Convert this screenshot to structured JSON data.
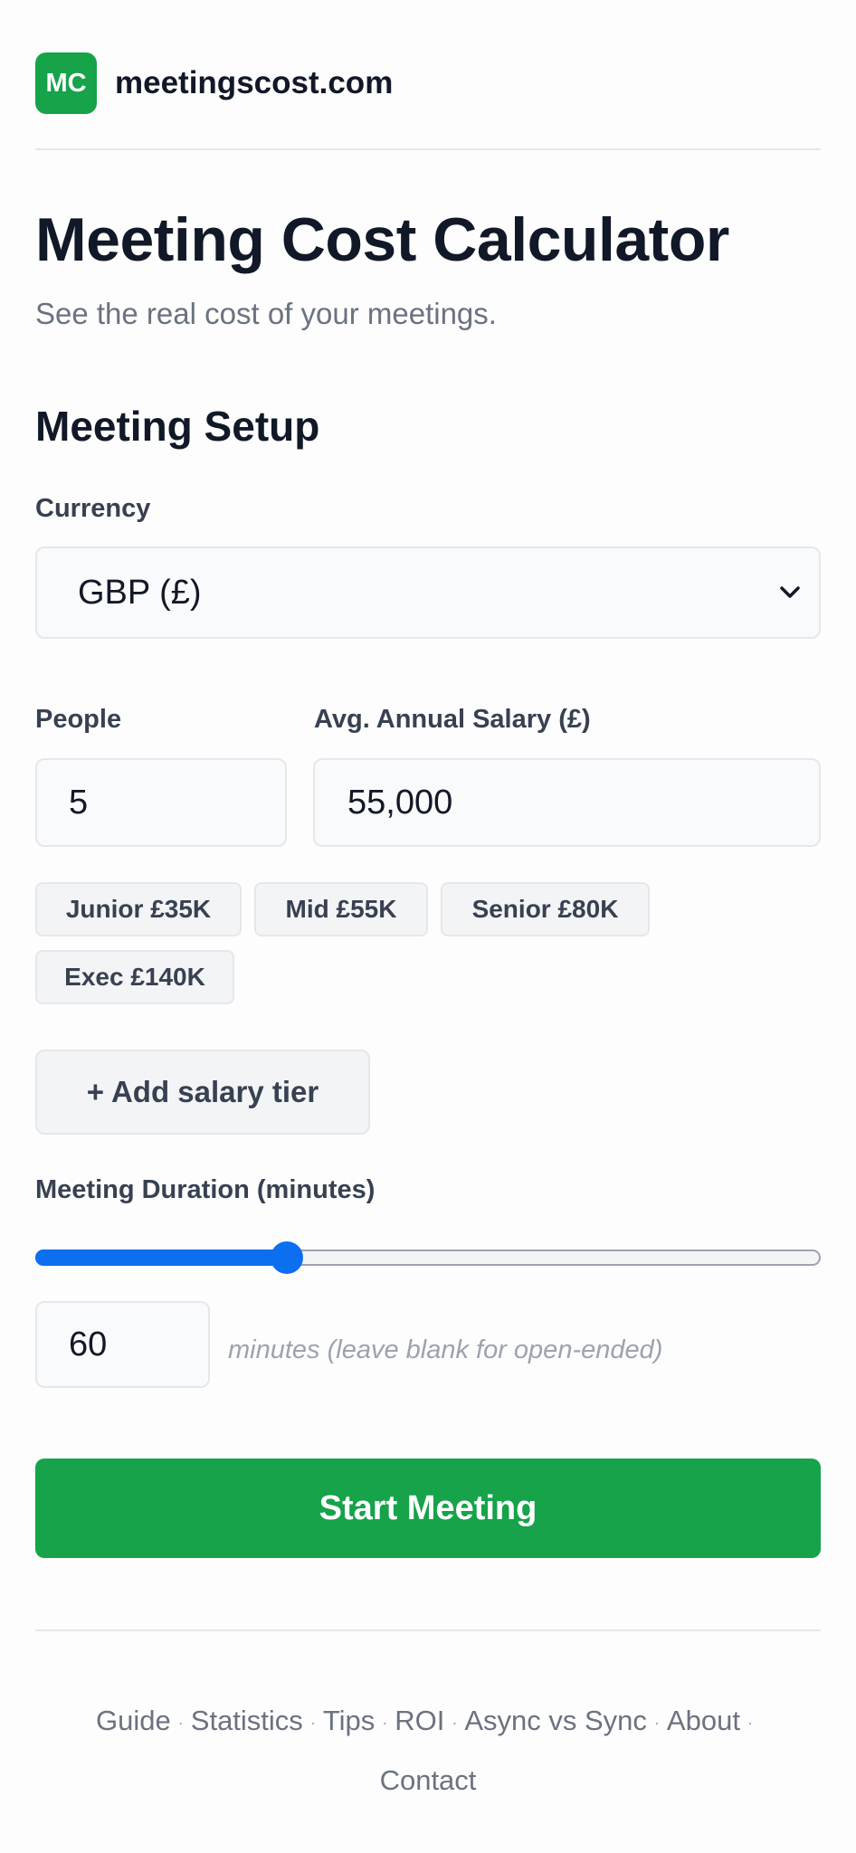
{
  "header": {
    "logo_text": "MC",
    "brand": "meetingscost.com"
  },
  "title": "Meeting Cost Calculator",
  "subtitle": "See the real cost of your meetings.",
  "setup": {
    "heading": "Meeting Setup",
    "currency_label": "Currency",
    "currency_value": "GBP (£)",
    "people_label": "People",
    "people_value": "5",
    "salary_label": "Avg. Annual Salary (£)",
    "salary_value": "55,000",
    "presets": [
      "Junior £35K",
      "Mid £55K",
      "Senior £80K",
      "Exec £140K"
    ],
    "add_tier": "+ Add salary tier",
    "duration_label": "Meeting Duration (minutes)",
    "duration_slider_fraction": 0.32,
    "duration_value": "60",
    "duration_hint": "minutes (leave blank for open-ended)",
    "start_button": "Start Meeting"
  },
  "footer": {
    "links": [
      "Guide",
      "Statistics",
      "Tips",
      "ROI",
      "Async vs Sync",
      "About",
      "Contact"
    ],
    "separator": "·"
  },
  "colors": {
    "brand_green": "#16a34a",
    "slider_blue": "#0b6ff0",
    "text_dark": "#111827",
    "text_muted": "#6b7280"
  }
}
